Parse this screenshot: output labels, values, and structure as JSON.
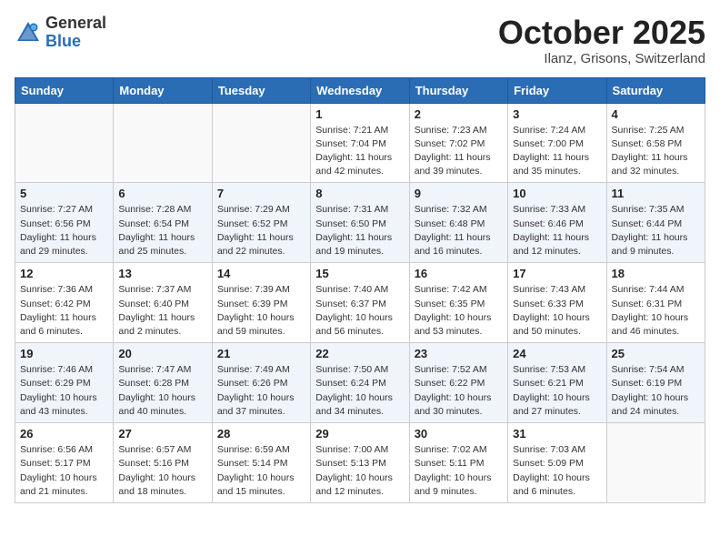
{
  "header": {
    "logo_general": "General",
    "logo_blue": "Blue",
    "month": "October 2025",
    "location": "Ilanz, Grisons, Switzerland"
  },
  "weekdays": [
    "Sunday",
    "Monday",
    "Tuesday",
    "Wednesday",
    "Thursday",
    "Friday",
    "Saturday"
  ],
  "weeks": [
    [
      {
        "day": "",
        "info": ""
      },
      {
        "day": "",
        "info": ""
      },
      {
        "day": "",
        "info": ""
      },
      {
        "day": "1",
        "info": "Sunrise: 7:21 AM\nSunset: 7:04 PM\nDaylight: 11 hours\nand 42 minutes."
      },
      {
        "day": "2",
        "info": "Sunrise: 7:23 AM\nSunset: 7:02 PM\nDaylight: 11 hours\nand 39 minutes."
      },
      {
        "day": "3",
        "info": "Sunrise: 7:24 AM\nSunset: 7:00 PM\nDaylight: 11 hours\nand 35 minutes."
      },
      {
        "day": "4",
        "info": "Sunrise: 7:25 AM\nSunset: 6:58 PM\nDaylight: 11 hours\nand 32 minutes."
      }
    ],
    [
      {
        "day": "5",
        "info": "Sunrise: 7:27 AM\nSunset: 6:56 PM\nDaylight: 11 hours\nand 29 minutes."
      },
      {
        "day": "6",
        "info": "Sunrise: 7:28 AM\nSunset: 6:54 PM\nDaylight: 11 hours\nand 25 minutes."
      },
      {
        "day": "7",
        "info": "Sunrise: 7:29 AM\nSunset: 6:52 PM\nDaylight: 11 hours\nand 22 minutes."
      },
      {
        "day": "8",
        "info": "Sunrise: 7:31 AM\nSunset: 6:50 PM\nDaylight: 11 hours\nand 19 minutes."
      },
      {
        "day": "9",
        "info": "Sunrise: 7:32 AM\nSunset: 6:48 PM\nDaylight: 11 hours\nand 16 minutes."
      },
      {
        "day": "10",
        "info": "Sunrise: 7:33 AM\nSunset: 6:46 PM\nDaylight: 11 hours\nand 12 minutes."
      },
      {
        "day": "11",
        "info": "Sunrise: 7:35 AM\nSunset: 6:44 PM\nDaylight: 11 hours\nand 9 minutes."
      }
    ],
    [
      {
        "day": "12",
        "info": "Sunrise: 7:36 AM\nSunset: 6:42 PM\nDaylight: 11 hours\nand 6 minutes."
      },
      {
        "day": "13",
        "info": "Sunrise: 7:37 AM\nSunset: 6:40 PM\nDaylight: 11 hours\nand 2 minutes."
      },
      {
        "day": "14",
        "info": "Sunrise: 7:39 AM\nSunset: 6:39 PM\nDaylight: 10 hours\nand 59 minutes."
      },
      {
        "day": "15",
        "info": "Sunrise: 7:40 AM\nSunset: 6:37 PM\nDaylight: 10 hours\nand 56 minutes."
      },
      {
        "day": "16",
        "info": "Sunrise: 7:42 AM\nSunset: 6:35 PM\nDaylight: 10 hours\nand 53 minutes."
      },
      {
        "day": "17",
        "info": "Sunrise: 7:43 AM\nSunset: 6:33 PM\nDaylight: 10 hours\nand 50 minutes."
      },
      {
        "day": "18",
        "info": "Sunrise: 7:44 AM\nSunset: 6:31 PM\nDaylight: 10 hours\nand 46 minutes."
      }
    ],
    [
      {
        "day": "19",
        "info": "Sunrise: 7:46 AM\nSunset: 6:29 PM\nDaylight: 10 hours\nand 43 minutes."
      },
      {
        "day": "20",
        "info": "Sunrise: 7:47 AM\nSunset: 6:28 PM\nDaylight: 10 hours\nand 40 minutes."
      },
      {
        "day": "21",
        "info": "Sunrise: 7:49 AM\nSunset: 6:26 PM\nDaylight: 10 hours\nand 37 minutes."
      },
      {
        "day": "22",
        "info": "Sunrise: 7:50 AM\nSunset: 6:24 PM\nDaylight: 10 hours\nand 34 minutes."
      },
      {
        "day": "23",
        "info": "Sunrise: 7:52 AM\nSunset: 6:22 PM\nDaylight: 10 hours\nand 30 minutes."
      },
      {
        "day": "24",
        "info": "Sunrise: 7:53 AM\nSunset: 6:21 PM\nDaylight: 10 hours\nand 27 minutes."
      },
      {
        "day": "25",
        "info": "Sunrise: 7:54 AM\nSunset: 6:19 PM\nDaylight: 10 hours\nand 24 minutes."
      }
    ],
    [
      {
        "day": "26",
        "info": "Sunrise: 6:56 AM\nSunset: 5:17 PM\nDaylight: 10 hours\nand 21 minutes."
      },
      {
        "day": "27",
        "info": "Sunrise: 6:57 AM\nSunset: 5:16 PM\nDaylight: 10 hours\nand 18 minutes."
      },
      {
        "day": "28",
        "info": "Sunrise: 6:59 AM\nSunset: 5:14 PM\nDaylight: 10 hours\nand 15 minutes."
      },
      {
        "day": "29",
        "info": "Sunrise: 7:00 AM\nSunset: 5:13 PM\nDaylight: 10 hours\nand 12 minutes."
      },
      {
        "day": "30",
        "info": "Sunrise: 7:02 AM\nSunset: 5:11 PM\nDaylight: 10 hours\nand 9 minutes."
      },
      {
        "day": "31",
        "info": "Sunrise: 7:03 AM\nSunset: 5:09 PM\nDaylight: 10 hours\nand 6 minutes."
      },
      {
        "day": "",
        "info": ""
      }
    ]
  ]
}
